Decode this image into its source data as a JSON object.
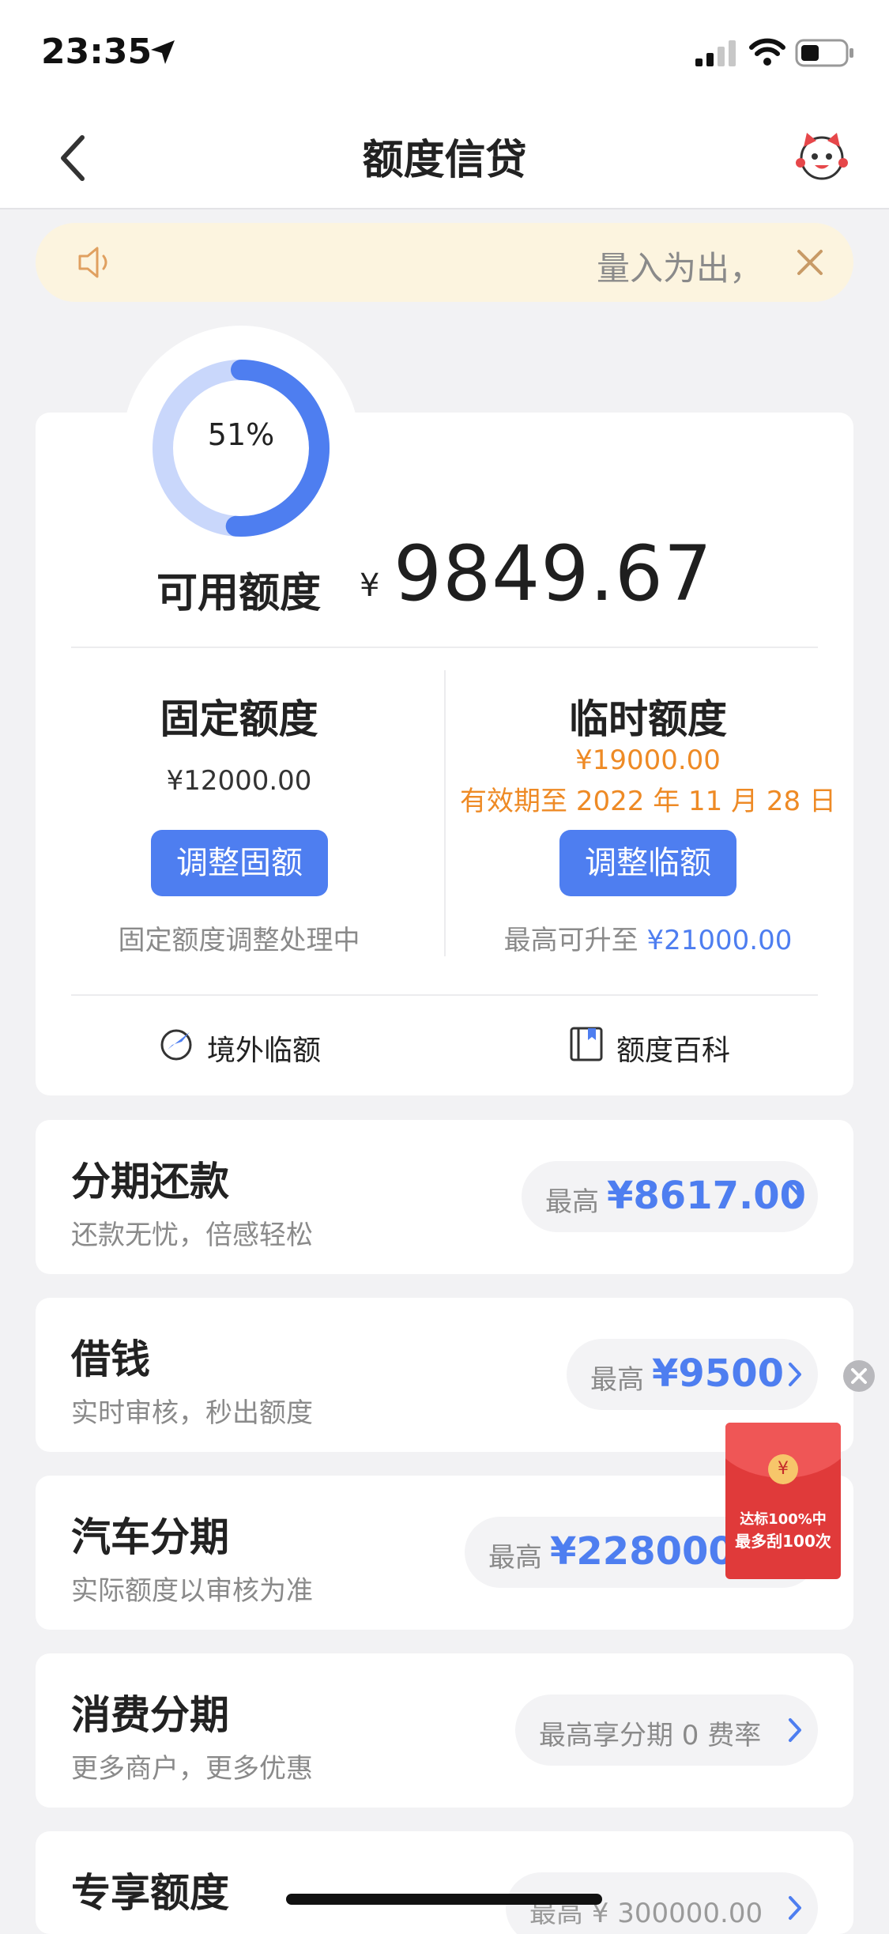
{
  "status_bar": {
    "time": "23:35"
  },
  "nav": {
    "title": "额度信贷"
  },
  "notice": {
    "text": "量入为出，"
  },
  "credit": {
    "percent_label": "51%",
    "percent_value": 0.51,
    "available_label": "可用额度",
    "currency": "¥",
    "available_value": "9849.67"
  },
  "fixed": {
    "title": "固定额度",
    "amount": "¥12000.00",
    "button": "调整固额",
    "status": "固定额度调整处理中"
  },
  "temporary": {
    "title": "临时额度",
    "amount": "¥19000.00",
    "validity": "有效期至 2022 年 11 月 28 日",
    "button": "调整临额",
    "max_prefix": "最高可升至",
    "max_value": "¥21000.00"
  },
  "links": {
    "overseas": "境外临额",
    "wiki": "额度百科"
  },
  "products": [
    {
      "title": "分期还款",
      "subtitle": "还款无忧，倍感轻松",
      "pill_prefix": "最高",
      "pill_value": "¥8617.00"
    },
    {
      "title": "借钱",
      "subtitle": "实时审核，秒出额度",
      "pill_prefix": "最高",
      "pill_value": "¥9500"
    },
    {
      "title": "汽车分期",
      "subtitle": "实际额度以审核为准",
      "pill_prefix": "最高",
      "pill_value": "¥228000.0"
    },
    {
      "title": "消费分期",
      "subtitle": "更多商户，更多优惠",
      "pill_prefix": "最高享分期 0 费率",
      "pill_value": ""
    },
    {
      "title": "专享额度",
      "subtitle": "",
      "pill_prefix": "最高 ¥ 300000.00",
      "pill_value": ""
    }
  ],
  "red_packet": {
    "line1": "达标100%中",
    "line2": "最多刮100次",
    "currency": "¥"
  },
  "colors": {
    "accent": "#4e7ef0",
    "orange": "#ee8a25",
    "notice_bg": "#fcf4df",
    "red_packet": "#e03a3a"
  },
  "icons": [
    "location-arrow-icon",
    "signal-icon",
    "wifi-icon",
    "battery-icon",
    "back-chevron-icon",
    "mascot-avatar-icon",
    "speaker-icon",
    "close-icon",
    "globe-plane-icon",
    "book-icon",
    "chevron-right-icon"
  ]
}
